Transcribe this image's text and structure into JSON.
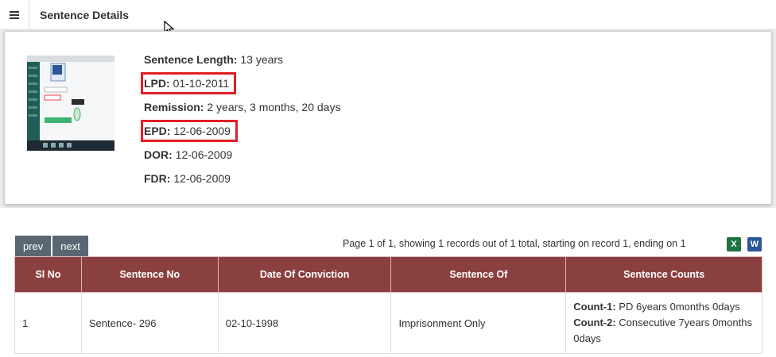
{
  "header": {
    "title": "Sentence Details"
  },
  "details": {
    "sentence_length_label": "Sentence Length:",
    "sentence_length": "13 years",
    "lpd_label": "LPD:",
    "lpd": "01-10-2011",
    "remission_label": "Remission:",
    "remission": "2 years, 3 months, 20 days",
    "epd_label": "EPD:",
    "epd": "12-06-2009",
    "dor_label": "DOR:",
    "dor": "12-06-2009",
    "fdr_label": "FDR:",
    "fdr": "12-06-2009",
    "highlight_color": "#e21e26"
  },
  "pager": {
    "prev": "prev",
    "next": "next",
    "info": "Page 1 of 1, showing 1 records out of 1 total, starting on record 1, ending on 1"
  },
  "table": {
    "headers": [
      "Sl No",
      "Sentence No",
      "Date Of Conviction",
      "Sentence Of",
      "Sentence Counts"
    ],
    "rows": [
      {
        "sl": "1",
        "sentence_no": "Sentence- 296",
        "date": "02-10-1998",
        "sentence_of": "Imprisonment Only",
        "count1_label": "Count-1:",
        "count1": "PD 6years 0months 0days",
        "count2_label": "Count-2:",
        "count2": "Consecutive 7years 0months 0days"
      }
    ],
    "header_color": "#8b4040"
  },
  "icons": {
    "excel": "X",
    "word": "W"
  }
}
